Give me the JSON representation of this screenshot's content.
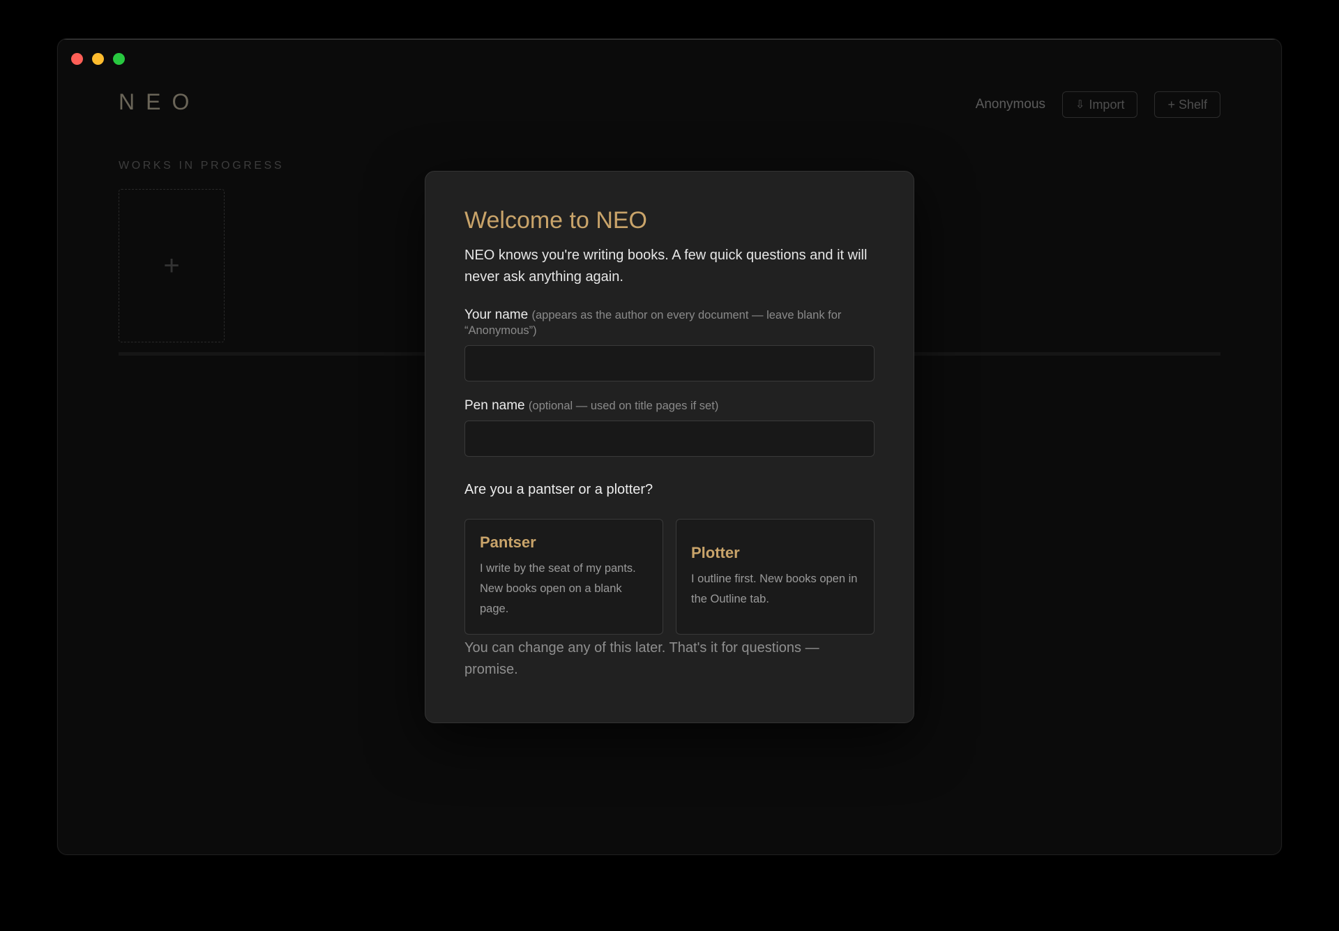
{
  "app": {
    "logo": "NEO",
    "user_name": "Anonymous",
    "import_label": "Import",
    "import_icon": "download-icon",
    "shelf_label": "+ Shelf"
  },
  "main": {
    "section_label": "WORKS IN PROGRESS",
    "new_book_glyph": "+"
  },
  "modal": {
    "title": "Welcome to NEO",
    "intro": "NEO knows you're writing books. A few quick questions and it will never ask anything again.",
    "name_field": {
      "label": "Your name",
      "hint": "(appears as the author on every document — leave blank for “Anonymous”)",
      "value": ""
    },
    "pen_name_field": {
      "label": "Pen name",
      "hint": "(optional — used on title pages if set)",
      "value": ""
    },
    "question": "Are you a pantser or a plotter?",
    "choices": [
      {
        "title": "Pantser",
        "description": "I write by the seat of my pants. New books open on a blank page."
      },
      {
        "title": "Plotter",
        "description": "I outline first. New books open in the Outline tab."
      }
    ],
    "footnote": "You can change any of this later. That's it for questions — promise."
  },
  "colors": {
    "accent": "#c9a46a",
    "background": "#0b0b0b",
    "modal_bg": "#212121"
  }
}
